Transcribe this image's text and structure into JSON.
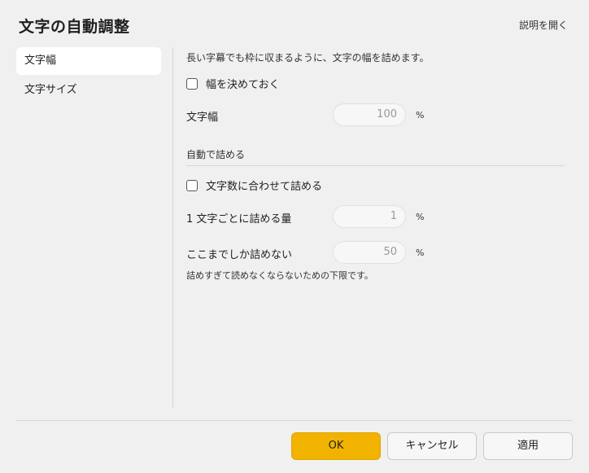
{
  "dialog": {
    "title": "文字の自動調整",
    "help_link": "説明を開く"
  },
  "sidebar": {
    "items": [
      {
        "label": "文字幅",
        "active": true
      },
      {
        "label": "文字サイズ",
        "active": false
      }
    ]
  },
  "content": {
    "description": "長い字幕でも枠に収まるように、文字の幅を詰めます。",
    "fix_width_checkbox": {
      "label": "幅を決めておく",
      "checked": false
    },
    "char_width": {
      "label": "文字幅",
      "value": "100",
      "unit": "%"
    },
    "auto_section": {
      "heading": "自動で詰める"
    },
    "auto_checkbox": {
      "label": "文字数に合わせて詰める",
      "checked": false
    },
    "per_char": {
      "label": "1 文字ごとに詰める量",
      "value": "1",
      "unit": "%"
    },
    "limit": {
      "label": "ここまでしか詰めない",
      "value": "50",
      "unit": "%"
    },
    "limit_note": "詰めすぎて読めなくならないための下限です。"
  },
  "footer": {
    "ok_label": "OK",
    "cancel_label": "キャンセル",
    "apply_label": "適用"
  },
  "colors": {
    "accent": "#f2b300",
    "background": "#f0f0f0"
  }
}
